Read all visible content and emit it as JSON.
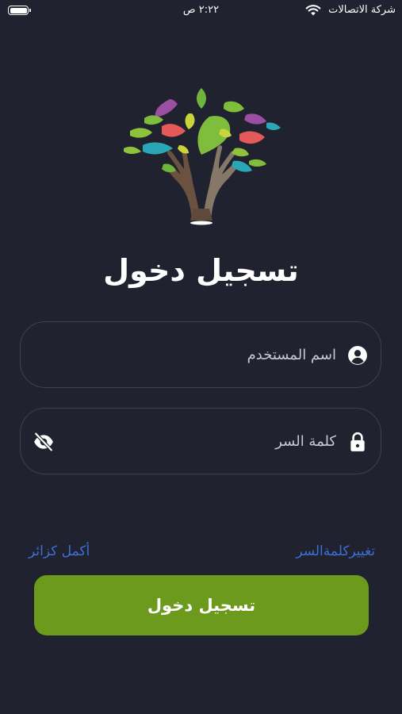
{
  "status_bar": {
    "time": "٢:٢٢ ص",
    "carrier": "شركة الاتصالات"
  },
  "page_title": "تسجيل دخول",
  "username_field": {
    "placeholder": "اسم المستخدم",
    "value": ""
  },
  "password_field": {
    "placeholder": "كلمة السر",
    "value": ""
  },
  "links": {
    "guest": "أكمل كزائر",
    "change_password": "تغييركلمةالسر"
  },
  "login_button": "تسجيل دخول",
  "colors": {
    "background": "#20222f",
    "button": "#6b9a1c",
    "link": "#3c6fd4"
  },
  "icons": [
    "battery-icon",
    "wifi-icon",
    "tree-hands-logo",
    "user-icon",
    "lock-icon",
    "eye-slash-icon"
  ]
}
